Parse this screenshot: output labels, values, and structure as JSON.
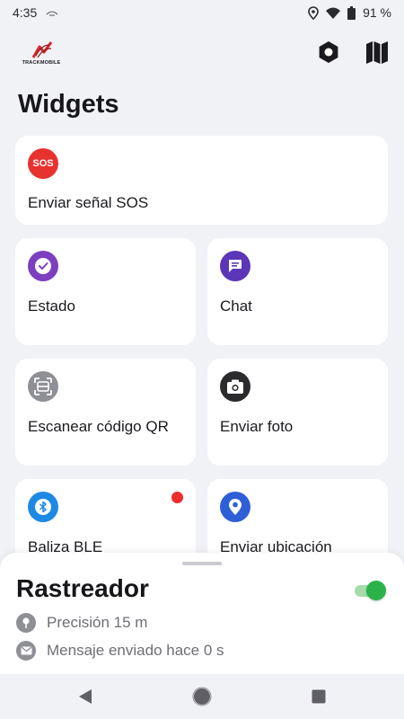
{
  "status_bar": {
    "time": "4:35",
    "battery": "91 %",
    "icons": [
      "location-icon",
      "wifi-icon",
      "battery-icon"
    ]
  },
  "app_bar": {
    "brand": "TRACKMOBILE",
    "actions": [
      "settings-icon",
      "map-icon"
    ]
  },
  "page": {
    "title": "Widgets"
  },
  "widgets": [
    {
      "label": "Enviar señal SOS",
      "icon": "sos-icon",
      "icon_text": "SOS",
      "color": "#e8322d"
    },
    {
      "label": "Estado",
      "icon": "check-circle-icon",
      "color": "#7c3fbf"
    },
    {
      "label": "Chat",
      "icon": "chat-icon",
      "color": "#5b37b8"
    },
    {
      "label": "Escanear código QR",
      "icon": "qr-scan-icon",
      "color": "#8f8f96"
    },
    {
      "label": "Enviar foto",
      "icon": "camera-icon",
      "color": "#2b2b2e"
    },
    {
      "label": "Baliza BLE",
      "icon": "bluetooth-icon",
      "color": "#1e88e5",
      "has_alert": true
    },
    {
      "label": "Enviar ubicación",
      "icon": "location-pin-icon",
      "color": "#2f5fd6"
    }
  ],
  "tracker": {
    "title": "Rastreador",
    "enabled": true,
    "accuracy": "Precisión 15 m",
    "last_message": "Mensaje enviado hace 0 s",
    "accent": "#2bb34a"
  },
  "nav_bar": [
    "back-icon",
    "home-icon",
    "recents-icon"
  ]
}
